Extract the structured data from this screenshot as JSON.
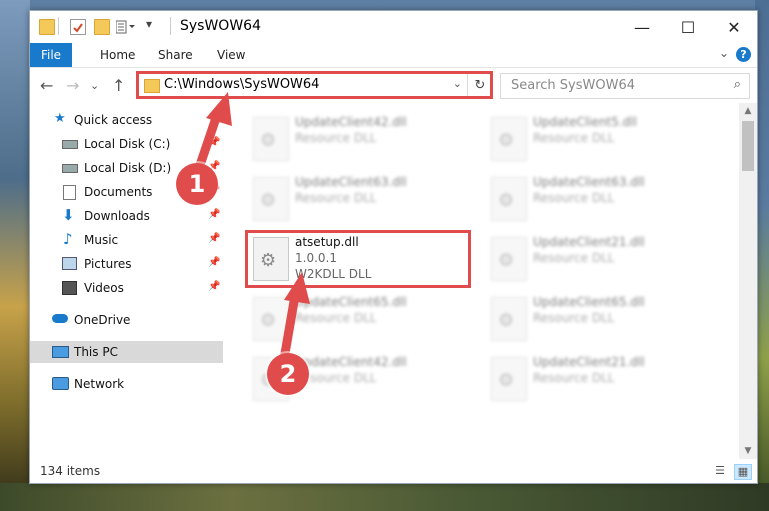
{
  "window": {
    "title": "SysWOW64",
    "controls": {
      "minimize": "—",
      "maximize": "☐",
      "close": "✕"
    }
  },
  "ribbon": {
    "tabs": [
      {
        "label": "File"
      },
      {
        "label": "Home"
      },
      {
        "label": "Share"
      },
      {
        "label": "View"
      }
    ],
    "help": "?"
  },
  "address": {
    "path": "C:\\Windows\\SysWOW64",
    "search_placeholder": "Search SysWOW64"
  },
  "nav": {
    "items": [
      {
        "label": "Quick access",
        "icon": "star-icon"
      },
      {
        "label": "Local Disk (C:)",
        "icon": "drive-icon",
        "pinned": true
      },
      {
        "label": "Local Disk (D:)",
        "icon": "drive-icon",
        "pinned": true
      },
      {
        "label": "Documents",
        "icon": "documents-icon",
        "pinned": true
      },
      {
        "label": "Downloads",
        "icon": "download-icon",
        "pinned": true
      },
      {
        "label": "Music",
        "icon": "music-icon",
        "pinned": true
      },
      {
        "label": "Pictures",
        "icon": "pictures-icon",
        "pinned": true
      },
      {
        "label": "Videos",
        "icon": "videos-icon",
        "pinned": true
      },
      {
        "label": "OneDrive",
        "icon": "cloud-icon"
      },
      {
        "label": "This PC",
        "icon": "computer-icon",
        "selected": true
      },
      {
        "label": "Network",
        "icon": "network-icon"
      }
    ]
  },
  "files": [
    {
      "name": "UpdateClient42.dll",
      "sub": "Resource DLL"
    },
    {
      "name": "UpdateClient5.dll",
      "sub": "Resource DLL"
    },
    {
      "name": "UpdateClient63.dll",
      "sub": "Resource DLL"
    },
    {
      "name": "UpdateClient63.dll",
      "sub": "Resource DLL"
    },
    {
      "name": "atsetup.dll",
      "version": "1.0.0.1",
      "sub": "W2KDLL DLL",
      "highlighted": true
    },
    {
      "name": "UpdateClient21.dll",
      "sub": "Resource DLL"
    },
    {
      "name": "UpdateClient65.dll",
      "sub": "Resource DLL"
    },
    {
      "name": "UpdateClient65.dll",
      "sub": "Resource DLL"
    },
    {
      "name": "UpdateClient42.dll",
      "sub": "Resource DLL"
    },
    {
      "name": "UpdateClient21.dll",
      "sub": "Resource DLL"
    }
  ],
  "status": {
    "count": "134 items"
  },
  "callouts": {
    "one": "1",
    "two": "2"
  },
  "colors": {
    "accent": "#1979ca",
    "highlight": "#e04c4c",
    "folder": "#f4c95a"
  }
}
